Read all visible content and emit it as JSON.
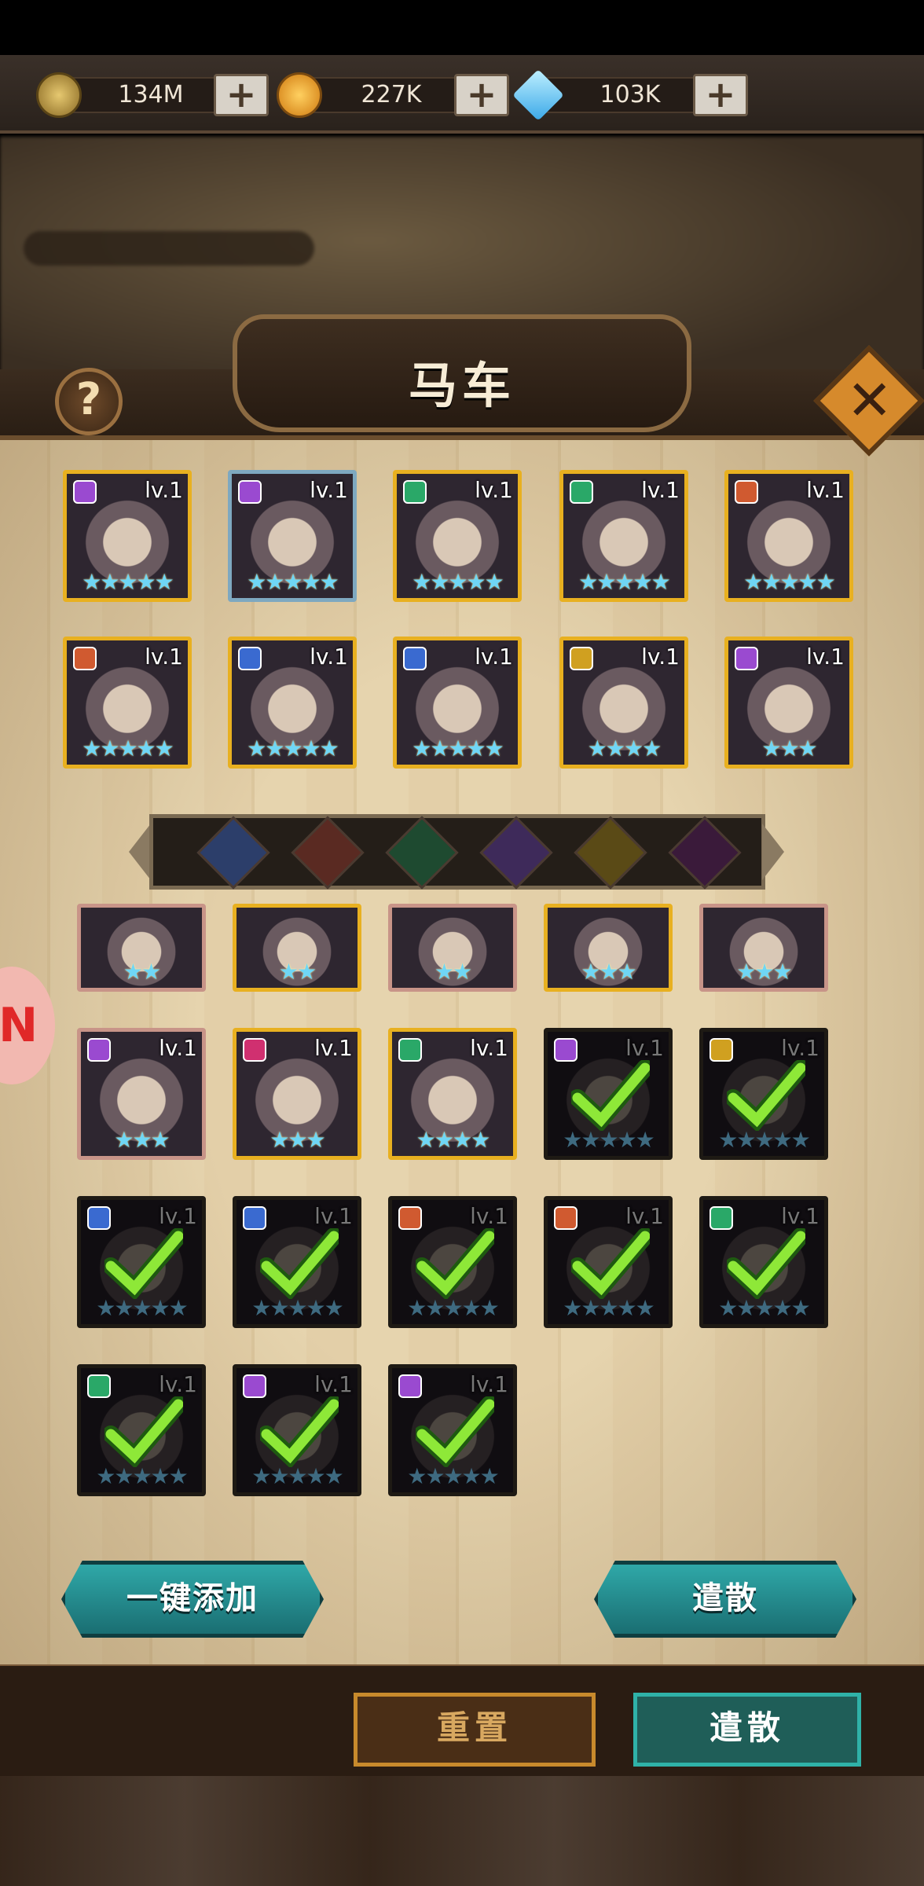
{
  "currencies": [
    {
      "name": "gold-coin",
      "value": "134M",
      "color": "#c9a24a"
    },
    {
      "name": "orange-token",
      "value": "227K",
      "color": "#f0a020"
    },
    {
      "name": "diamond",
      "value": "103K",
      "color": "#6ad0f8"
    }
  ],
  "plus_label": "+",
  "title": "马车",
  "help_label": "?",
  "close_label": "✕",
  "selected_heroes": [
    {
      "level": "lv.1",
      "stars": "★★★★★",
      "class_color": "#9a4ad0",
      "frame": "gold"
    },
    {
      "level": "lv.1",
      "stars": "★★★★★",
      "class_color": "#9a4ad0",
      "frame": "blue"
    },
    {
      "level": "lv.1",
      "stars": "★★★★★",
      "class_color": "#2aa868",
      "frame": "gold"
    },
    {
      "level": "lv.1",
      "stars": "★★★★★",
      "class_color": "#2aa868",
      "frame": "gold"
    },
    {
      "level": "lv.1",
      "stars": "★★★★★",
      "class_color": "#d05a30",
      "frame": "gold"
    },
    {
      "level": "lv.1",
      "stars": "★★★★★",
      "class_color": "#d05a30",
      "frame": "gold"
    },
    {
      "level": "lv.1",
      "stars": "★★★★★",
      "class_color": "#3a6ad0",
      "frame": "gold"
    },
    {
      "level": "lv.1",
      "stars": "★★★★★",
      "class_color": "#3a6ad0",
      "frame": "gold"
    },
    {
      "level": "lv.1",
      "stars": "★★★★",
      "class_color": "#d0a020",
      "frame": "gold"
    },
    {
      "level": "lv.1",
      "stars": "★★★",
      "class_color": "#9a4ad0",
      "frame": "gold"
    }
  ],
  "filters": [
    {
      "name": "filter-blue",
      "color": "#2c3e6a"
    },
    {
      "name": "filter-red",
      "color": "#5a2a22"
    },
    {
      "name": "filter-green",
      "color": "#1e4a30"
    },
    {
      "name": "filter-purple",
      "color": "#3e2a5a"
    },
    {
      "name": "filter-yellow",
      "color": "#5a4a16"
    },
    {
      "name": "filter-violet",
      "color": "#3a1a3a"
    }
  ],
  "inventory_partial": [
    {
      "stars": "★★",
      "frame": "pink"
    },
    {
      "stars": "★★",
      "frame": "gold"
    },
    {
      "stars": "★★",
      "frame": "pink"
    },
    {
      "stars": "★★★",
      "frame": "gold"
    },
    {
      "stars": "★★★",
      "frame": "pink"
    }
  ],
  "inventory": [
    {
      "level": "lv.1",
      "stars": "★★★",
      "class_color": "#9a4ad0",
      "frame": "pink",
      "selected": false
    },
    {
      "level": "lv.1",
      "stars": "★★★",
      "class_color": "#d03070",
      "frame": "gold",
      "selected": false
    },
    {
      "level": "lv.1",
      "stars": "★★★★",
      "class_color": "#2aa868",
      "frame": "gold",
      "selected": false
    },
    {
      "level": "lv.1",
      "stars": "★★★★★",
      "class_color": "#9a4ad0",
      "frame": "dark",
      "selected": true
    },
    {
      "level": "lv.1",
      "stars": "★★★★★",
      "class_color": "#d0a020",
      "frame": "dark",
      "selected": true
    },
    {
      "level": "lv.1",
      "stars": "★★★★★",
      "class_color": "#3a6ad0",
      "frame": "dark",
      "selected": true
    },
    {
      "level": "lv.1",
      "stars": "★★★★★",
      "class_color": "#3a6ad0",
      "frame": "dark",
      "selected": true
    },
    {
      "level": "lv.1",
      "stars": "★★★★★",
      "class_color": "#d05a30",
      "frame": "dark",
      "selected": true
    },
    {
      "level": "lv.1",
      "stars": "★★★★★",
      "class_color": "#d05a30",
      "frame": "dark",
      "selected": true
    },
    {
      "level": "lv.1",
      "stars": "★★★★★",
      "class_color": "#2aa868",
      "frame": "dark",
      "selected": true
    },
    {
      "level": "lv.1",
      "stars": "★★★★★",
      "class_color": "#2aa868",
      "frame": "dark",
      "selected": true
    },
    {
      "level": "lv.1",
      "stars": "★★★★★",
      "class_color": "#9a4ad0",
      "frame": "dark",
      "selected": true
    },
    {
      "level": "lv.1",
      "stars": "★★★★★",
      "class_color": "#9a4ad0",
      "frame": "dark",
      "selected": true
    }
  ],
  "side_bubble_label": "N",
  "actions": {
    "auto_add": "一键添加",
    "dismiss": "遣散"
  },
  "footer": {
    "reset": "重置",
    "dismiss": "遣散"
  }
}
